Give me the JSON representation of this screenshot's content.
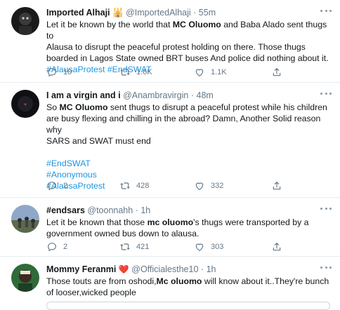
{
  "tweets": [
    {
      "name": "Imported Alhaji",
      "name_suffix": "🕌",
      "handle": "@ImportedAlhaji",
      "time": "55m",
      "text_lines": [
        [
          {
            "t": "Let it be known by the world that "
          },
          {
            "t": "MC Oluomo",
            "b": true
          },
          {
            "t": " and Baba Alado sent thugs to"
          }
        ],
        [
          {
            "t": "Alausa to disrupt the peaceful protest holding on there. Those thugs"
          }
        ],
        [
          {
            "t": "boarded in Lagos State owned BRT buses And police did nothing about it."
          }
        ],
        [
          {
            "t": "#AlausaProtest #EndSWAT",
            "link": true
          }
        ]
      ],
      "replies": "10",
      "retweets": "1.6K",
      "likes": "1.1K"
    },
    {
      "name": "I am a virgin and i",
      "name_suffix": "",
      "handle": "@Anambravirgin",
      "time": "48m",
      "text_lines": [
        [
          {
            "t": "So "
          },
          {
            "t": "MC Oluomo",
            "b": true
          },
          {
            "t": " sent thugs to disrupt a peaceful protest while his children"
          }
        ],
        [
          {
            "t": "are busy flexing and chilling in the abroad? Damn, Another Solid reason why"
          }
        ],
        [
          {
            "t": "SARS and SWAT must end"
          }
        ],
        [],
        [
          {
            "t": "#EndSWAT",
            "link": true
          }
        ],
        [
          {
            "t": "#Anonymous",
            "link": true
          }
        ],
        [
          {
            "t": "#AlausaProtest",
            "link": true
          }
        ]
      ],
      "replies": "2",
      "retweets": "428",
      "likes": "332"
    },
    {
      "name": "#endsars",
      "name_suffix": "",
      "handle": "@toonnahh",
      "time": "1h",
      "text_lines": [
        [
          {
            "t": "Let it be known that those "
          },
          {
            "t": "mc oluomo",
            "b": true
          },
          {
            "t": "'s thugs were transported by a"
          }
        ],
        [
          {
            "t": "government owned bus down to alausa."
          }
        ]
      ],
      "replies": "2",
      "retweets": "421",
      "likes": "303"
    },
    {
      "name": "Mommy Feranmi",
      "name_suffix": "❤️",
      "handle": "@Officialesthe10",
      "time": "1h",
      "text_lines": [
        [
          {
            "t": "Those touts are from oshodi,"
          },
          {
            "t": "Mc oluomo",
            "b": true
          },
          {
            "t": " will know about it..They're bunch"
          }
        ],
        [
          {
            "t": "of looser,wicked people"
          }
        ]
      ]
    }
  ],
  "colors": {
    "link": "#1b95e0",
    "meta": "#657786",
    "border": "#e6ecf0"
  }
}
